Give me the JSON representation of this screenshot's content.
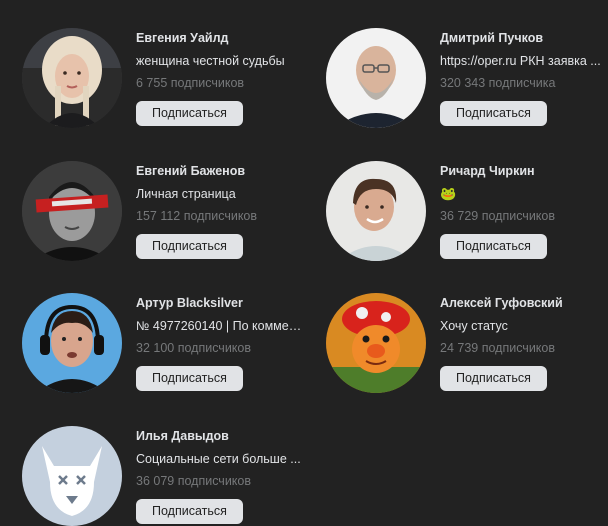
{
  "subscribe_label": "Подписаться",
  "cards": [
    {
      "name": "Евгения Уайлд",
      "status": "женщина честной судьбы",
      "subscribers": "6 755 подписчиков",
      "avatar_icon": "woman-photo-icon"
    },
    {
      "name": "Дмитрий Пучков",
      "status": "https://oper.ru РКН заявка ...",
      "subscribers": "320 343 подписчика",
      "avatar_icon": "man-glasses-photo-icon"
    },
    {
      "name": "Евгений Баженов",
      "status": "Личная страница",
      "subscribers": "157 112 подписчиков",
      "avatar_icon": "man-redtape-photo-icon"
    },
    {
      "name": "Ричард Чиркин",
      "status": "🐸",
      "subscribers": "36 729 подписчиков",
      "avatar_icon": "man-smiling-photo-icon"
    },
    {
      "name": "Артур Blacksilver",
      "status": "№ 4977260140 | По коммер...",
      "subscribers": "32 100 подписчиков",
      "avatar_icon": "man-headphones-photo-icon"
    },
    {
      "name": "Алексей Гуфовский",
      "status": "Хочу статус",
      "subscribers": "24 739 подписчиков",
      "avatar_icon": "orange-toy-photo-icon"
    },
    {
      "name": "Илья Давыдов",
      "status": "Социальные сети больше ...",
      "subscribers": "36 079 подписчиков",
      "avatar_icon": "default-dog-avatar-icon"
    }
  ]
}
